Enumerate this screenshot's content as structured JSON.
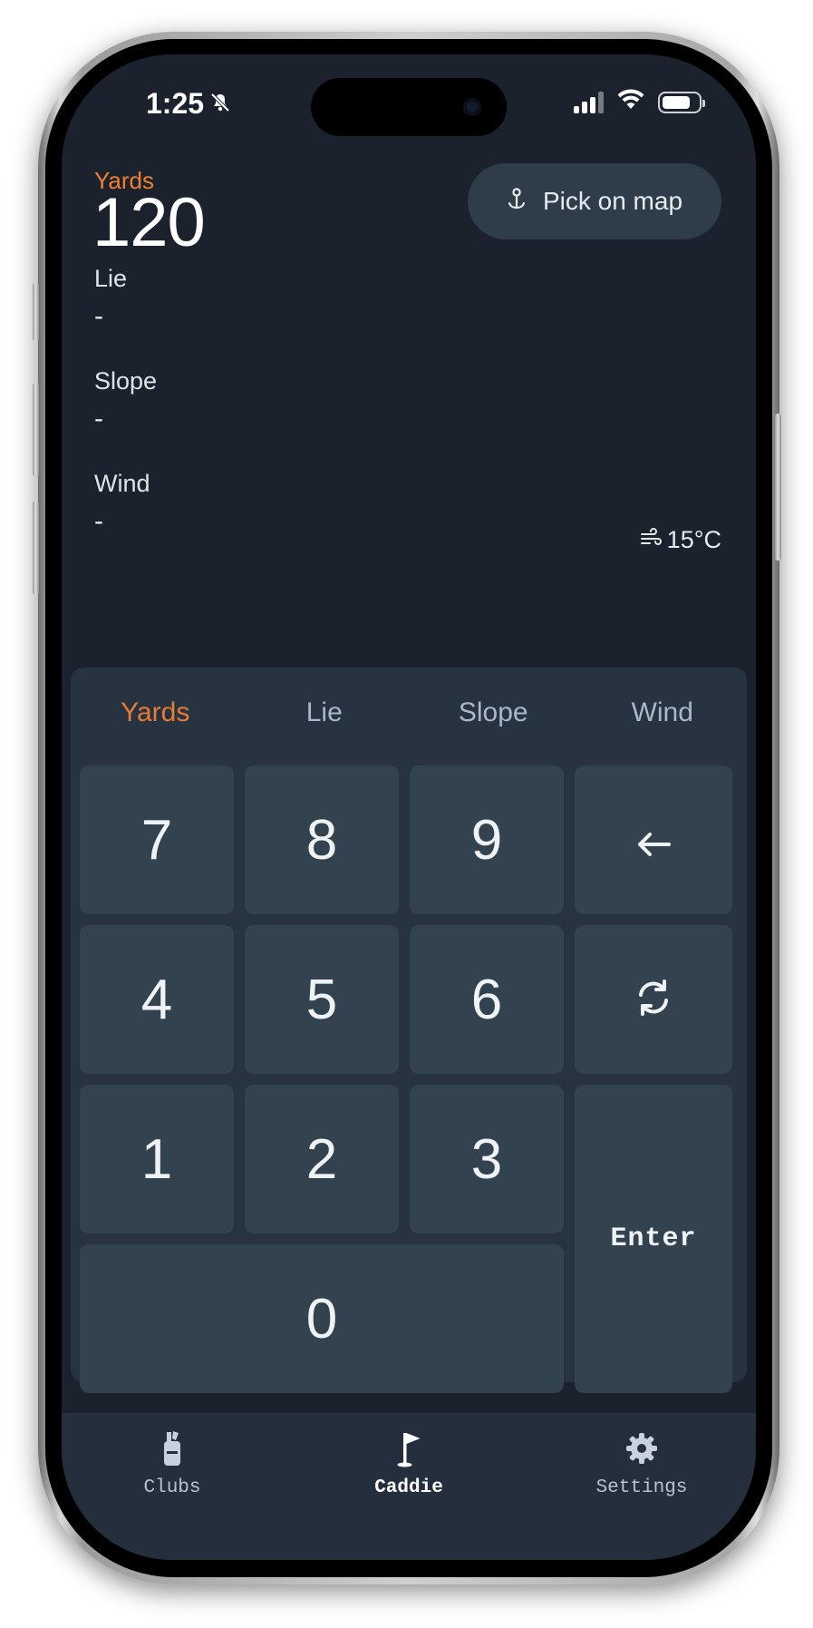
{
  "status_bar": {
    "time": "1:25",
    "icons": [
      "bell-slash-icon",
      "signal-icon",
      "wifi-icon",
      "battery-icon"
    ],
    "battery_level": 0.8
  },
  "header": {
    "yards_label": "Yards",
    "yards_value": "120",
    "map_button_label": "Pick on map",
    "map_button_icon": "anchor-pin-icon"
  },
  "fields": [
    {
      "label": "Lie",
      "value": "-"
    },
    {
      "label": "Slope",
      "value": "-"
    },
    {
      "label": "Wind",
      "value": "-"
    }
  ],
  "weather": {
    "icon": "wind-icon",
    "temperature": "15°C"
  },
  "keypad": {
    "tabs": [
      "Yards",
      "Lie",
      "Slope",
      "Wind"
    ],
    "active_tab": "Yards",
    "keys": [
      "7",
      "8",
      "9",
      "4",
      "5",
      "6",
      "1",
      "2",
      "3",
      "0"
    ],
    "backspace_icon": "arrow-left-icon",
    "reset_icon": "refresh-icon",
    "enter_label": "Enter"
  },
  "nav": {
    "items": [
      {
        "label": "Clubs",
        "icon": "golf-bag-icon"
      },
      {
        "label": "Caddie",
        "icon": "flag-icon"
      },
      {
        "label": "Settings",
        "icon": "gear-icon"
      }
    ],
    "active": "Caddie"
  },
  "colors": {
    "accent": "#f07f32",
    "background": "#1b222d",
    "keypad_panel": "#273340",
    "key": "#33424f",
    "nav_background": "#242e3d"
  }
}
